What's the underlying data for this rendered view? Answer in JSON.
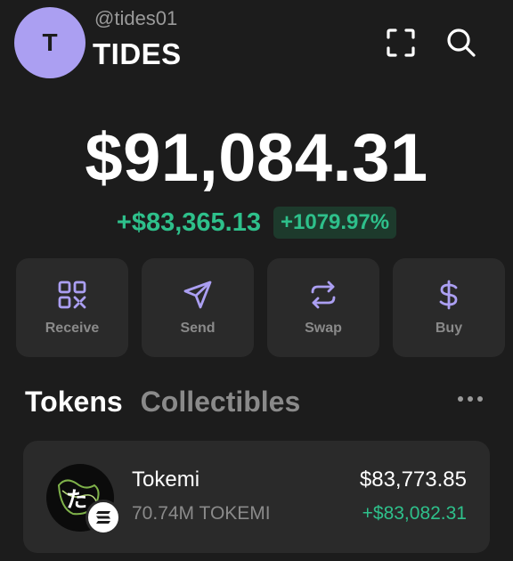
{
  "header": {
    "avatar_letter": "T",
    "handle": "@tides01",
    "account_name": "TIDES"
  },
  "portfolio": {
    "balance": "$91,084.31",
    "change_amount": "+$83,365.13",
    "change_percent": "+1079.97%"
  },
  "actions": [
    {
      "label": "Receive",
      "icon": "qr-code-icon"
    },
    {
      "label": "Send",
      "icon": "send-arrow-icon"
    },
    {
      "label": "Swap",
      "icon": "swap-arrows-icon"
    },
    {
      "label": "Buy",
      "icon": "dollar-icon"
    }
  ],
  "tabs": {
    "tokens": "Tokens",
    "collectibles": "Collectibles"
  },
  "tokens": [
    {
      "name": "Tokemi",
      "amount": "70.74M TOKEMI",
      "value": "$83,773.85",
      "change": "+$83,082.31",
      "logo_text": "た"
    }
  ],
  "colors": {
    "accent": "#ab9ff2",
    "positive": "#2ec08b",
    "background": "#1c1c1c",
    "card": "#2a2a2a"
  }
}
